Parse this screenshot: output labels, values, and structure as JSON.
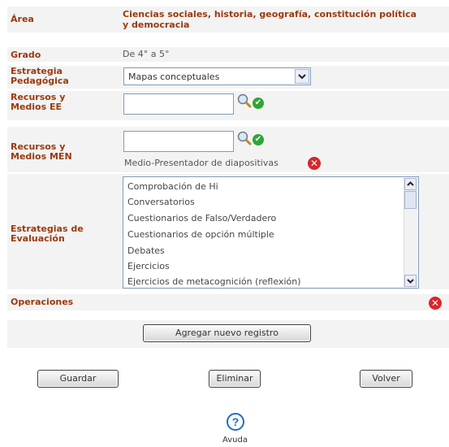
{
  "form": {
    "area_label": "Área",
    "area_value_line1": "Ciencias sociales, historia, geografía, constitución política",
    "area_value_line2": "y democracia",
    "grado_label": "Grado",
    "grado_value": "De 4° a 5°",
    "estrategia_label_line1": "Estrategia",
    "estrategia_label_line2": "Pedagógica",
    "estrategia_value": "Mapas conceptuales",
    "recursos_ee_label_line1": "Recursos y",
    "recursos_ee_label_line2": "Medios EE",
    "recursos_men_label_line1": "Recursos y",
    "recursos_men_label_line2": "Medios MEN",
    "recursos_men_item": "Medio-Presentador de diapositivas",
    "evaluacion_label_line1": "Estrategias de",
    "evaluacion_label_line2": "Evaluación",
    "evaluacion_options": [
      "Comprobación de Hi",
      "Conversatorios",
      "Cuestionarios de Falso/Verdadero",
      "Cuestionarios de opción múltiple",
      "Debates",
      "Ejercicios",
      "Ejercicios de metacognición (reflexión)"
    ],
    "operaciones_label": "Operaciones",
    "add_button": "Agregar nuevo registro"
  },
  "actions": {
    "save": "Guardar",
    "delete": "Eliminar",
    "back": "Volver"
  },
  "help": {
    "label": "Avuda"
  }
}
